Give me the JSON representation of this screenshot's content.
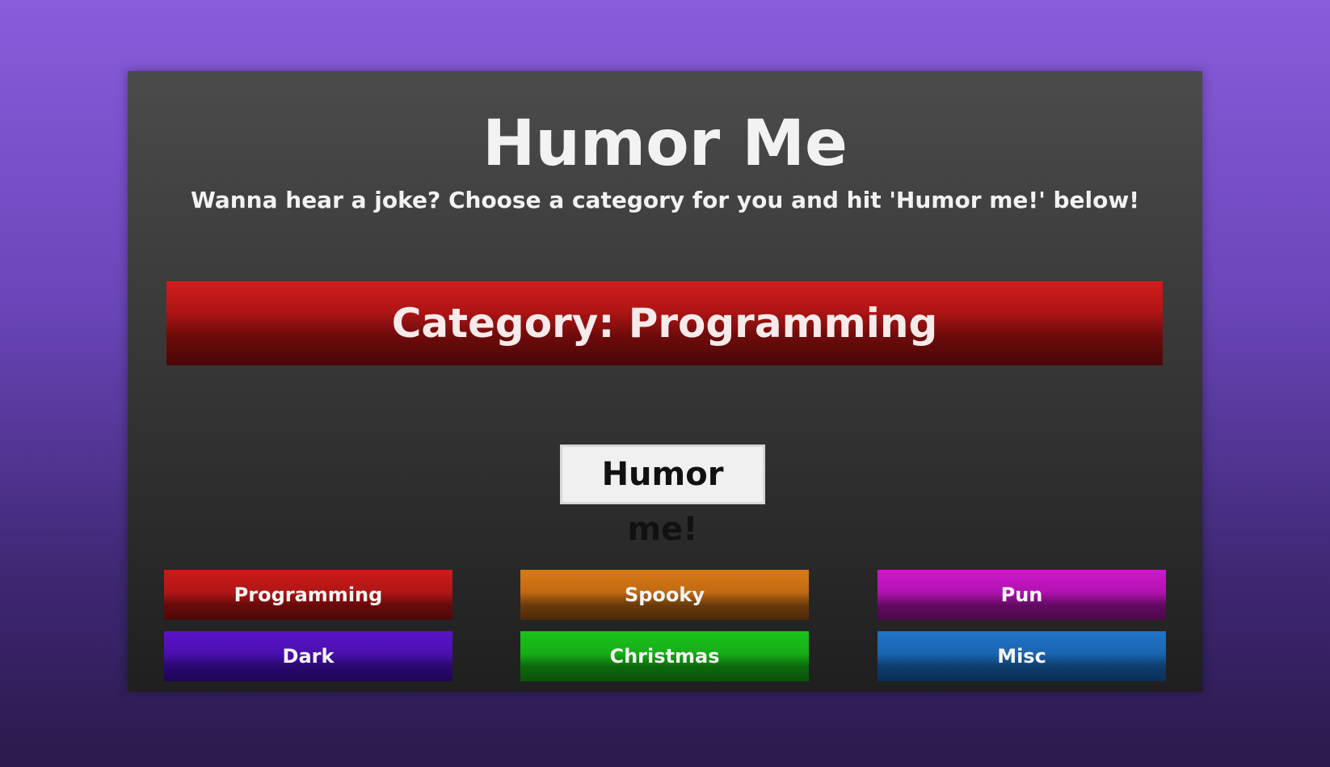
{
  "app": {
    "title": "Humor Me",
    "subtitle": "Wanna hear a joke? Choose a category for you and hit 'Humor me!' below!"
  },
  "category_banner": {
    "label": "Category: Programming"
  },
  "humor_button": {
    "label": "Humor me!"
  },
  "categories": [
    {
      "label": "Programming",
      "color": "#cf1a1a"
    },
    {
      "label": "Spooky",
      "color": "#d97a16"
    },
    {
      "label": "Pun",
      "color": "#cf17cf"
    },
    {
      "label": "Dark",
      "color": "#5a14c8"
    },
    {
      "label": "Christmas",
      "color": "#1ac41a"
    },
    {
      "label": "Misc",
      "color": "#1f74c9"
    }
  ],
  "colors": {
    "background_top": "#8a5cdc",
    "background_bottom": "#2a1a4c",
    "card": "#3a3a3a"
  }
}
